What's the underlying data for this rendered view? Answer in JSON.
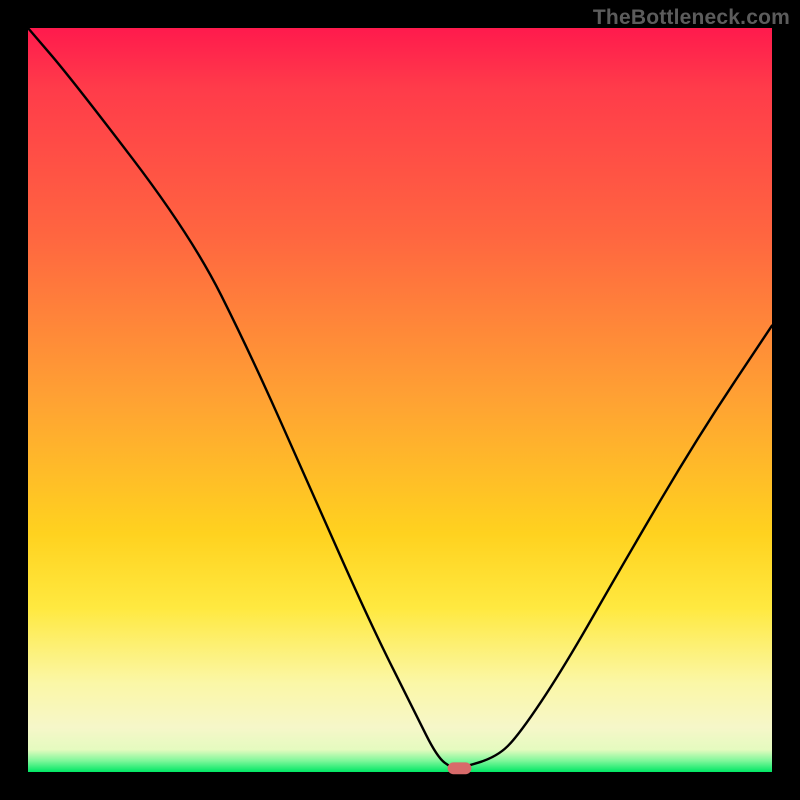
{
  "watermark": "TheBottleneck.com",
  "chart_data": {
    "type": "line",
    "title": "",
    "xlabel": "",
    "ylabel": "",
    "xlim": [
      0,
      100
    ],
    "ylim": [
      0,
      100
    ],
    "grid": false,
    "series": [
      {
        "name": "bottleneck-curve",
        "x": [
          0,
          6,
          22,
          30,
          38,
          46,
          52,
          55,
          57,
          58,
          63,
          66,
          72,
          80,
          90,
          100
        ],
        "values": [
          100,
          93,
          72,
          56,
          38,
          20,
          8,
          2,
          0.5,
          0.5,
          2,
          5,
          14,
          28,
          45,
          60
        ]
      }
    ],
    "marker": {
      "name": "optimum-marker",
      "x": 58,
      "y": 0.5,
      "width_pct": 3.2,
      "height_pct": 1.6,
      "color": "#d86a6a"
    },
    "gradient_bands": [
      {
        "pct": 0,
        "color": "#ff1a4d"
      },
      {
        "pct": 28,
        "color": "#ff6640"
      },
      {
        "pct": 50,
        "color": "#ffa233"
      },
      {
        "pct": 78,
        "color": "#ffe940"
      },
      {
        "pct": 94,
        "color": "#f6f7c9"
      },
      {
        "pct": 100,
        "color": "#00e765"
      }
    ]
  }
}
